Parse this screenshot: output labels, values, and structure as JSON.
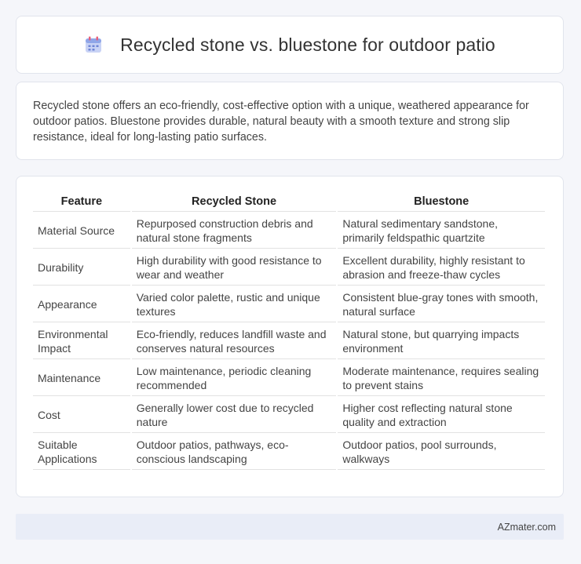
{
  "header": {
    "icon": "calendar-icon",
    "title": "Recycled stone vs. bluestone for outdoor patio"
  },
  "summary": {
    "text": "Recycled stone offers an eco-friendly, cost-effective option with a unique, weathered appearance for outdoor patios. Bluestone provides durable, natural beauty with a smooth texture and strong slip resistance, ideal for long-lasting patio surfaces."
  },
  "table": {
    "columns": [
      "Feature",
      "Recycled Stone",
      "Bluestone"
    ],
    "rows": [
      [
        "Material Source",
        "Repurposed construction debris and natural stone fragments",
        "Natural sedimentary sandstone, primarily feldspathic quartzite"
      ],
      [
        "Durability",
        "High durability with good resistance to wear and weather",
        "Excellent durability, highly resistant to abrasion and freeze-thaw cycles"
      ],
      [
        "Appearance",
        "Varied color palette, rustic and unique textures",
        "Consistent blue-gray tones with smooth, natural surface"
      ],
      [
        "Environmental Impact",
        "Eco-friendly, reduces landfill waste and conserves natural resources",
        "Natural stone, but quarrying impacts environment"
      ],
      [
        "Maintenance",
        "Low maintenance, periodic cleaning recommended",
        "Moderate maintenance, requires sealing to prevent stains"
      ],
      [
        "Cost",
        "Generally lower cost due to recycled nature",
        "Higher cost reflecting natural stone quality and extraction"
      ],
      [
        "Suitable Applications",
        "Outdoor patios, pathways, eco-conscious landscaping",
        "Outdoor patios, pool surrounds, walkways"
      ]
    ]
  },
  "footer": {
    "text": "AZmater.com"
  },
  "colors": {
    "background": "#f5f6fa",
    "card": "#ffffff",
    "footer": "#e9edf7",
    "icon_body": "#8fa6e8",
    "icon_top": "#e8607a"
  }
}
